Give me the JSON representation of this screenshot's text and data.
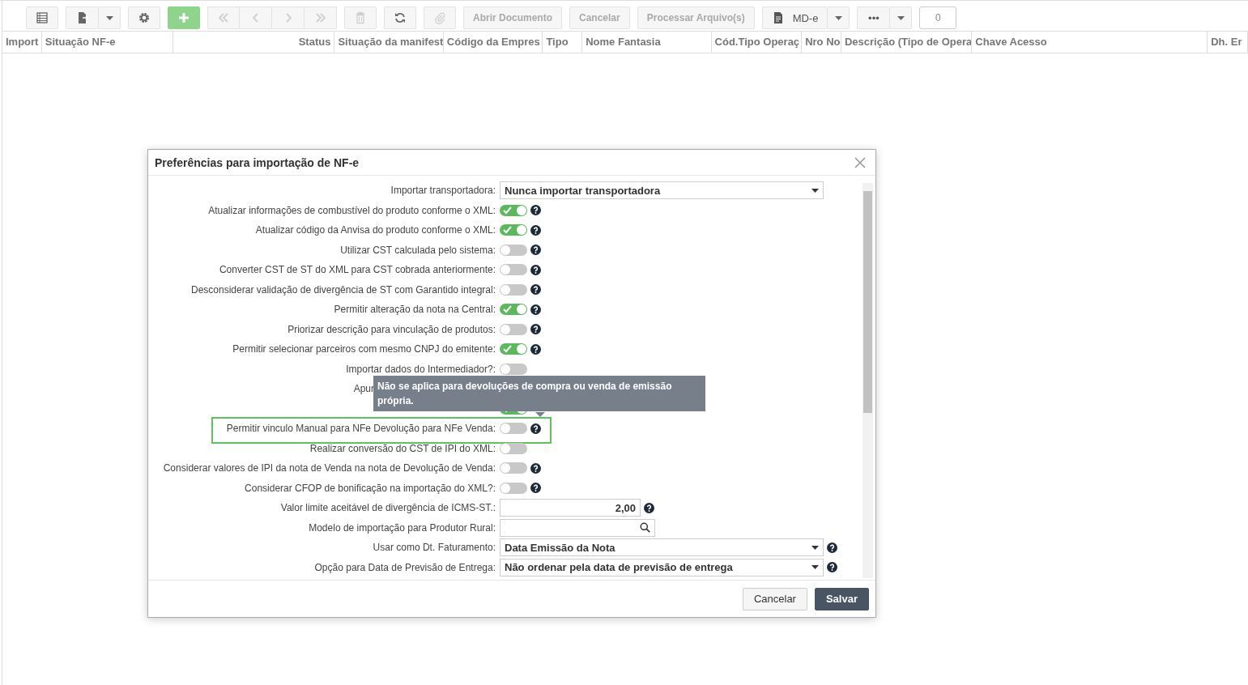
{
  "toolbar": [
    {
      "kind": "icon",
      "disabled": false
    },
    {
      "kind": "split-icon",
      "disabled": false
    },
    {
      "kind": "icon",
      "disabled": false
    },
    {
      "kind": "primary",
      "disabled": false
    },
    {
      "kind": "group",
      "items": [
        {
          "disabled": true
        },
        {
          "disabled": true
        },
        {
          "disabled": true
        },
        {
          "disabled": true
        }
      ]
    },
    {
      "kind": "icon",
      "disabled": true
    },
    {
      "kind": "icon",
      "disabled": false
    },
    {
      "kind": "icon",
      "disabled": true
    },
    {
      "kind": "text",
      "label": "Abrir Documento",
      "disabled": true
    },
    {
      "kind": "text",
      "label": "Cancelar",
      "disabled": true
    },
    {
      "kind": "text",
      "label": "Processar Arquivo(s)",
      "disabled": true
    },
    {
      "kind": "split-text",
      "label": "MD-e",
      "disabled": false
    },
    {
      "kind": "split-text",
      "label": "•••",
      "disabled": false
    },
    {
      "kind": "counter",
      "label": "0"
    }
  ],
  "table": {
    "columns": [
      "Import",
      "Situação NF-e",
      "Status",
      "Situação da manifest",
      "Código da Empres",
      "Tipo",
      "Nome Fantasia",
      "Cód.Tipo Operaç",
      "Nro No",
      "Descrição (Tipo de Opera",
      "Chave Acesso",
      "Dh. Er"
    ]
  },
  "dialog": {
    "title": "Preferências para importação de NF-e",
    "rows": [
      {
        "kind": "select",
        "label": "Importar transportadora:",
        "value": "Nunca importar transportadora",
        "help": false
      },
      {
        "kind": "toggle",
        "label": "Atualizar informações de combustível do produto conforme o XML:",
        "on": true,
        "help": true
      },
      {
        "kind": "toggle",
        "label": "Atualizar código da Anvisa do produto conforme o XML:",
        "on": true,
        "help": true
      },
      {
        "kind": "toggle",
        "label": "Utilizar CST calculada pelo sistema:",
        "on": false,
        "help": true
      },
      {
        "kind": "toggle",
        "label": "Converter CST de ST do XML para CST cobrada anteriormente:",
        "on": false,
        "help": true
      },
      {
        "kind": "toggle",
        "label": "Desconsiderar validação de divergência de ST com Garantido integral:",
        "on": false,
        "help": true
      },
      {
        "kind": "toggle",
        "label": "Permitir alteração da nota na Central:",
        "on": true,
        "help": true
      },
      {
        "kind": "toggle",
        "label": "Priorizar descrição para vinculação de produtos:",
        "on": false,
        "help": true
      },
      {
        "kind": "toggle",
        "label": "Permitir selecionar parceiros com mesmo CNPJ do emitente:",
        "on": true,
        "help": true
      },
      {
        "kind": "toggle",
        "label": "Importar dados do Intermediador?:",
        "on": false,
        "help": false
      },
      {
        "kind": "covered-label",
        "label": "Apur"
      },
      {
        "kind": "covered-toggle",
        "on": true
      },
      {
        "kind": "toggle",
        "label": "Permitir vinculo Manual para NFe Devolução para NFe Venda:",
        "on": false,
        "help": true,
        "highlighted": true
      },
      {
        "kind": "toggle",
        "label": "Realizar conversão do CST de IPI do XML:",
        "on": false,
        "help": false
      },
      {
        "kind": "toggle",
        "label": "Considerar valores de IPI da nota de Venda na nota de Devolução de Venda:",
        "on": false,
        "help": true
      },
      {
        "kind": "toggle",
        "label": "Considerar CFOP de bonificação na importação do XML?:",
        "on": false,
        "help": true
      },
      {
        "kind": "number",
        "label": "Valor limite aceitável de divergência de ICMS-ST.:",
        "value": "2,00",
        "help": true
      },
      {
        "kind": "search",
        "label": "Modelo de importação para Produtor Rural:",
        "value": "",
        "help": false
      },
      {
        "kind": "select",
        "label": "Usar como Dt. Faturamento:",
        "value": "Data Emissão da Nota",
        "help": true
      },
      {
        "kind": "select",
        "label": "Opção para Data de Previsão de Entrega:",
        "value": "Não ordenar pela data de previsão de entrega",
        "help": true
      }
    ],
    "tooltip": "Não se aplica para devoluções de compra ou venda de emissão própria.",
    "buttons": [
      {
        "label": "Cancelar",
        "kind": "default"
      },
      {
        "label": "Salvar",
        "kind": "primary"
      }
    ]
  }
}
